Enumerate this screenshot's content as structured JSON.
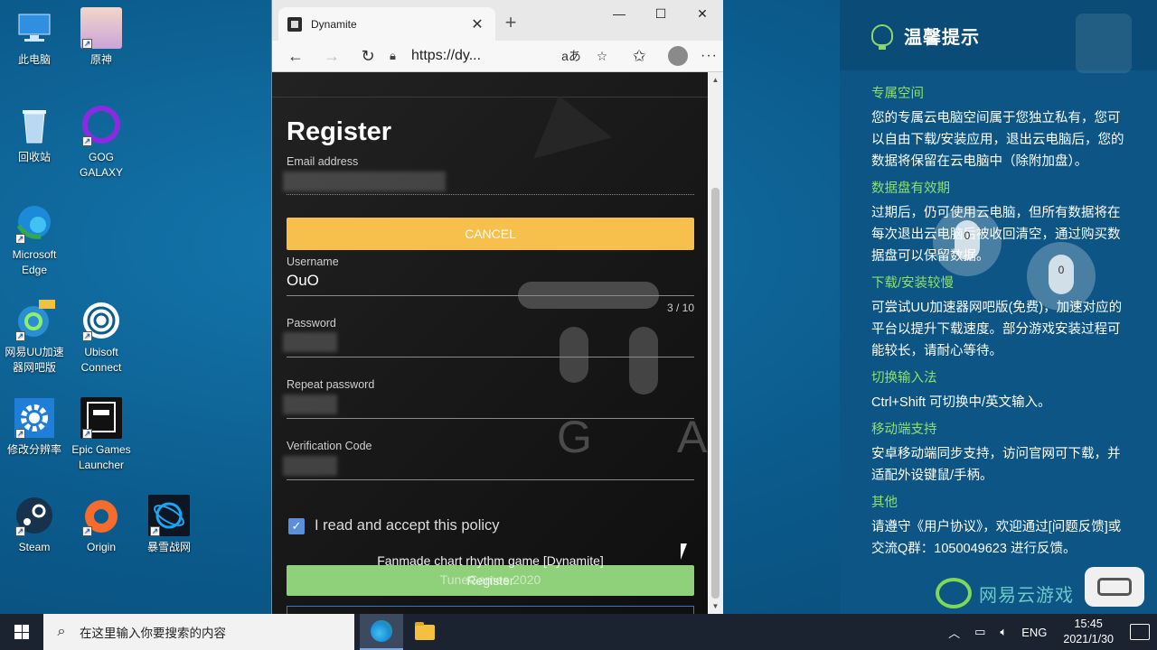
{
  "desktop": {
    "icons": [
      {
        "label": "此电脑"
      },
      {
        "label": "原神"
      },
      {
        "label": "回收站"
      },
      {
        "label": "GOG GALAXY"
      },
      {
        "label": "Microsoft Edge"
      },
      {
        "label": "网易UU加速器网吧版"
      },
      {
        "label": "Ubisoft Connect"
      },
      {
        "label": "修改分辨率"
      },
      {
        "label": "Epic Games Launcher"
      },
      {
        "label": "Steam"
      },
      {
        "label": "Origin"
      },
      {
        "label": "暴雪战网"
      }
    ]
  },
  "browser": {
    "tab_title": "Dynamite",
    "close_tab": "✕",
    "new_tab": "+",
    "url": "https://dy...",
    "window_controls": {
      "minimize": "—",
      "maximize": "☐",
      "close": "✕"
    },
    "read_aloud": "aあ",
    "menu": "···"
  },
  "page": {
    "title": "Register",
    "email_label": "Email address",
    "cancel_label": "CANCEL",
    "username_label": "Username",
    "username_value": "OuO",
    "username_counter": "3 / 10",
    "password_label": "Password",
    "repeat_password_label": "Repeat password",
    "verification_label": "Verification Code",
    "policy_label": "I read and accept this policy",
    "register_label": "Register",
    "footer_line1": "Fanmade chart rhythm game [Dynamite]",
    "footer_line2": "TuneGames 2020",
    "bg_letters": {
      "g": "G",
      "a": "A"
    }
  },
  "tips_panel": {
    "title": "温馨提示",
    "sections": [
      {
        "heading": "专属空间",
        "text": "您的专属云电脑空间属于您独立私有，您可以自由下载/安装应用，退出云电脑后，您的数据将保留在云电脑中（除附加盘）。"
      },
      {
        "heading": "数据盘有效期",
        "text": "过期后，仍可使用云电脑，但所有数据将在每次退出云电脑后被收回清空，通过购买数据盘可以保留数据。"
      },
      {
        "heading": "下载/安装较慢",
        "text": "可尝试UU加速器网吧版(免费)，加速对应的平台以提升下载速度。部分游戏安装过程可能较长，请耐心等待。"
      },
      {
        "heading": "切换输入法",
        "text": "Ctrl+Shift 可切换中/英文输入。"
      },
      {
        "heading": "移动端支持",
        "text": "安卓移动端同步支持，访问官网可下载，并适配外设键鼠/手柄。"
      },
      {
        "heading": "其他",
        "text": "请遵守《用户协议》，欢迎通过[问题反馈]或交流Q群：1050049623 进行反馈。"
      }
    ],
    "brand": "网易云游戏",
    "mouse_overlays": [
      "0",
      "0"
    ]
  },
  "taskbar": {
    "search_placeholder": "在这里输入你要搜索的内容",
    "lang": "ENG",
    "time": "15:45",
    "date": "2021/1/30"
  },
  "colors": {
    "cancel": "#f7bf4c",
    "register": "#8fd07a",
    "accent_green": "#8ee06a",
    "panel_bg": "#0c5585"
  }
}
